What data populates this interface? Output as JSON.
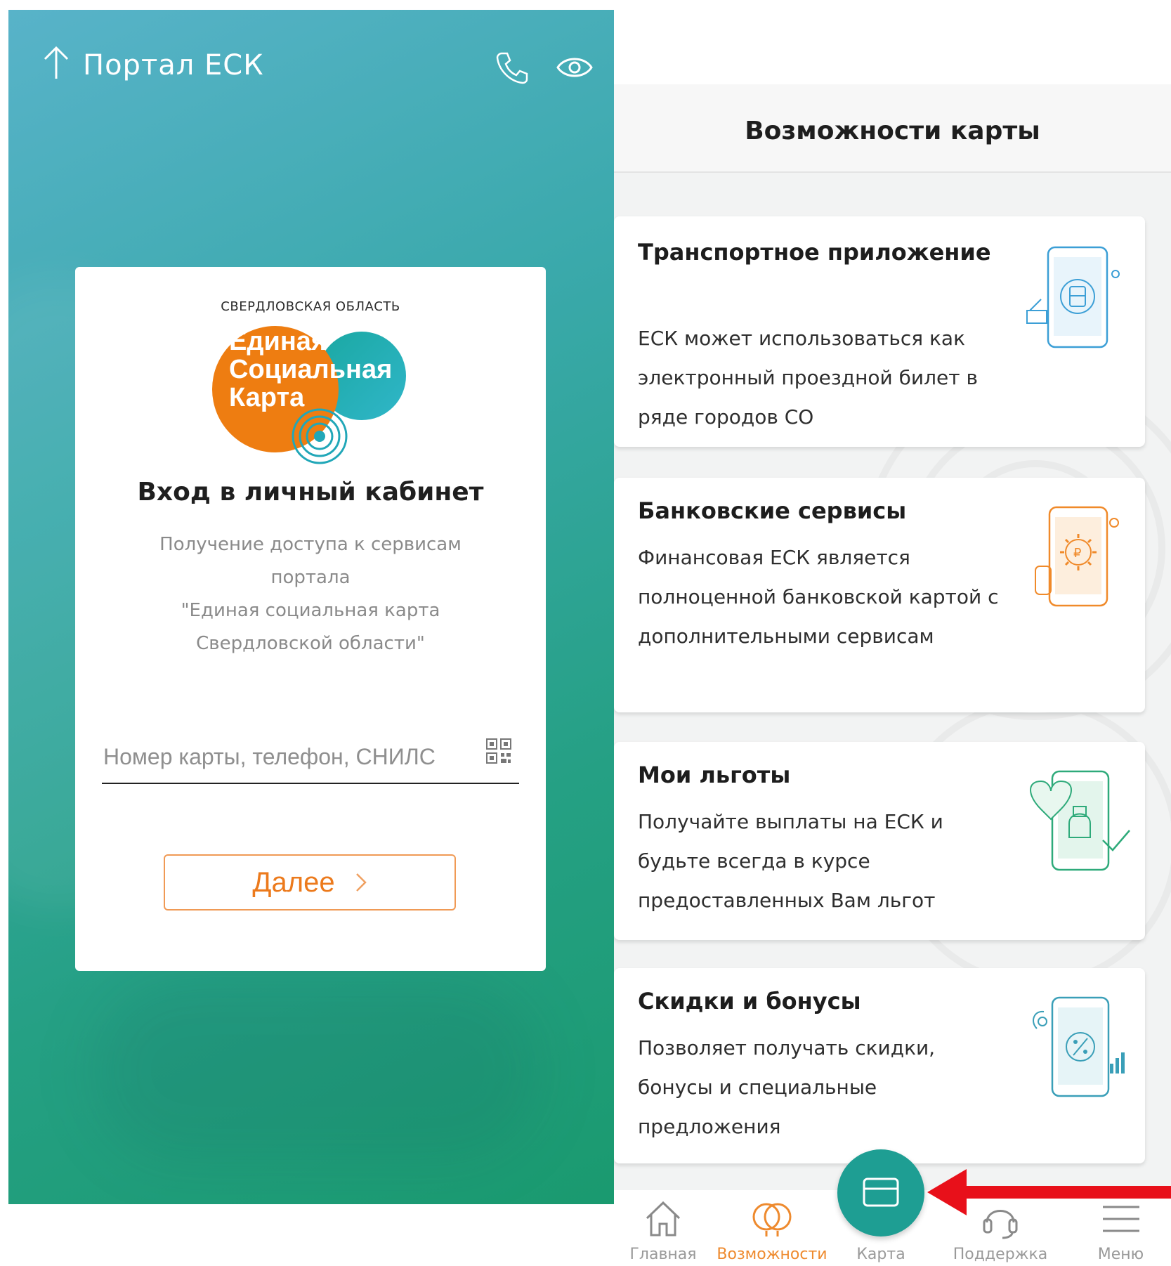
{
  "left_screen": {
    "header": {
      "title": "Портал ЕСК"
    },
    "logo": {
      "caption": "СВЕРДЛОВСКАЯ ОБЛАСТЬ",
      "line1": "Единая",
      "line2": "Социальная",
      "line3": "Карта"
    },
    "login": {
      "title": "Вход в личный кабинет",
      "desc_line1": "Получение доступа к сервисам",
      "desc_line2": "портала",
      "desc_line3": "\"Единая социальная карта",
      "desc_line4": "Свердловской области\"",
      "input_placeholder": "Номер карты, телефон, СНИЛС",
      "input_value": "",
      "next_label": "Далее"
    }
  },
  "right_screen": {
    "title": "Возможности карты",
    "features": [
      {
        "title": "Транспортное приложение",
        "desc": "ЕСК может использоваться как электронный проездной билет в ряде городов СО",
        "icon": "transport-phone-icon",
        "color": "#3c9fd6"
      },
      {
        "title": "Банковские сервисы",
        "desc": "Финансовая ЕСК является полноценной банковской картой с дополнительными сервисам",
        "icon": "bank-phone-icon",
        "color": "#f08a2a"
      },
      {
        "title": "Мои льготы",
        "desc": "Получайте выплаты на ЕСК и будьте всегда в курсе предоставленных Вам льгот",
        "icon": "benefits-phone-icon",
        "color": "#2eaa7a"
      },
      {
        "title": "Скидки и бонусы",
        "desc": "Позволяет получать скидки, бонусы и специальные предложения",
        "icon": "discount-phone-icon",
        "color": "#3a9fb8"
      }
    ],
    "bottom_nav": [
      {
        "label": "Главная",
        "icon": "home-icon",
        "active": false
      },
      {
        "label": "Возможности",
        "icon": "features-icon",
        "active": true
      },
      {
        "label": "Карта",
        "icon": "card-icon",
        "active": false
      },
      {
        "label": "Поддержка",
        "icon": "headset-icon",
        "active": false
      },
      {
        "label": "Меню",
        "icon": "menu-icon",
        "active": false
      }
    ]
  },
  "colors": {
    "accent_orange": "#ec7a1c",
    "accent_teal": "#1e9e93",
    "annotation_red": "#e8101a"
  }
}
